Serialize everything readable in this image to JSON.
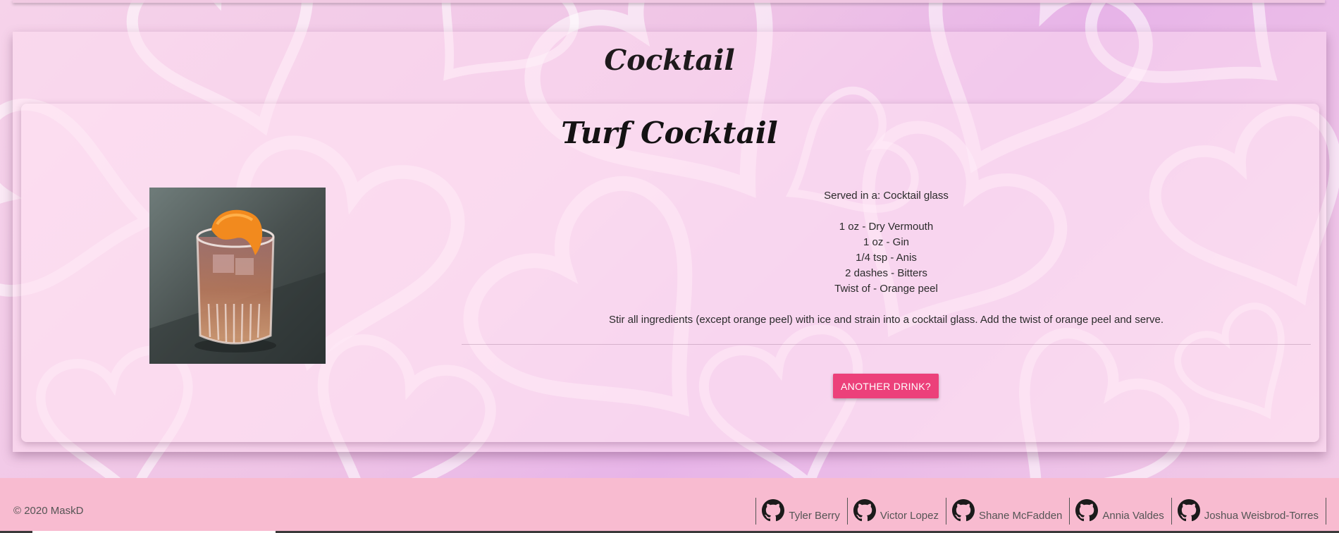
{
  "section": {
    "title": "Cocktail"
  },
  "drink": {
    "name": "Turf Cocktail",
    "glass_line": "Served in a: Cocktail glass",
    "ingredients": [
      "1 oz - Dry Vermouth",
      "1 oz - Gin",
      "1/4 tsp - Anis",
      "2 dashes - Bitters",
      "Twist of - Orange peel"
    ],
    "instructions": "Stir all ingredients (except orange peel) with ice and strain into a cocktail glass. Add the twist of orange peel and serve.",
    "photo_icon": "cocktail-glass-with-orange-peel"
  },
  "actions": {
    "another_label": "ANOTHER DRINK?"
  },
  "footer": {
    "copyright": "© 2020 MaskD",
    "contributors": [
      {
        "name": "Tyler Berry",
        "icon": "github-icon"
      },
      {
        "name": "Victor Lopez",
        "icon": "github-icon"
      },
      {
        "name": "Shane McFadden",
        "icon": "github-icon"
      },
      {
        "name": "Annia Valdes",
        "icon": "github-icon"
      },
      {
        "name": "Joshua Weisbrod-Torres",
        "icon": "github-icon"
      }
    ]
  },
  "colors": {
    "accent": "#ec407a",
    "footer_bg": "#f8bbd0",
    "background": "#efc4e6"
  }
}
